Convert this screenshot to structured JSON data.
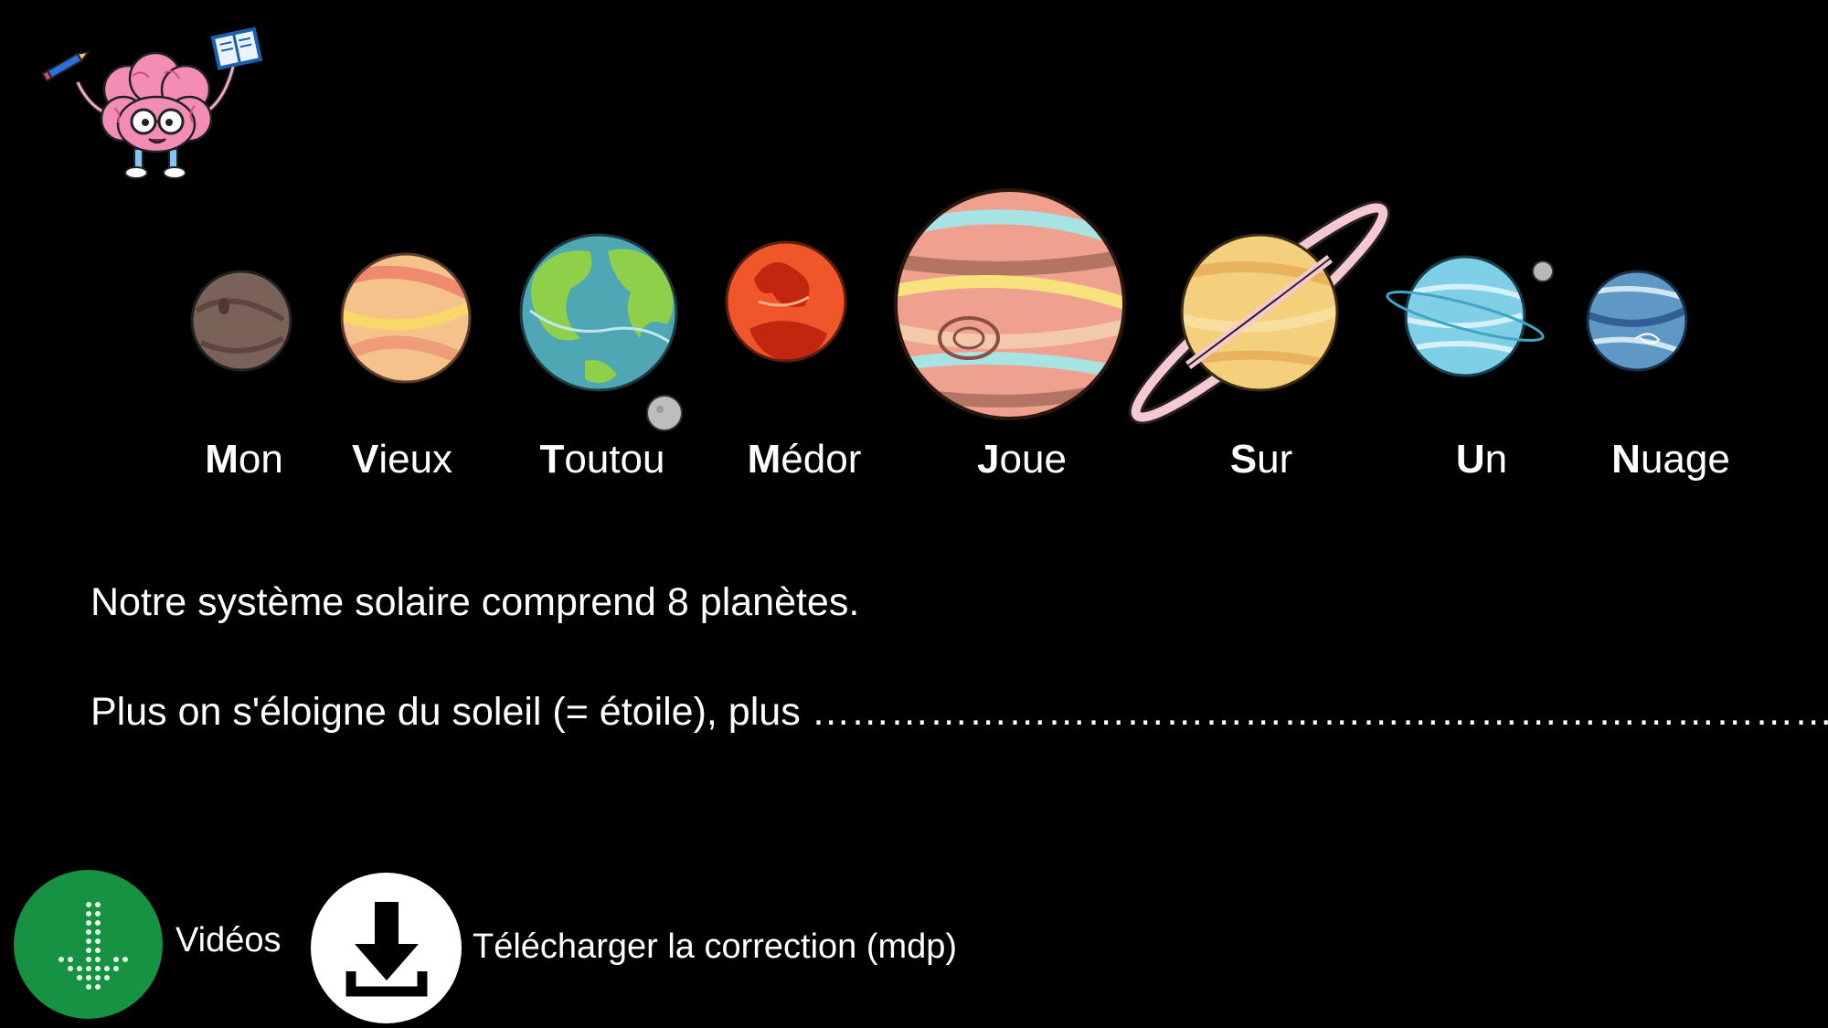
{
  "planets": [
    {
      "first": "M",
      "rest": "on"
    },
    {
      "first": "V",
      "rest": "ieux"
    },
    {
      "first": "T",
      "rest": "outou"
    },
    {
      "first": "M",
      "rest": "édor"
    },
    {
      "first": "J",
      "rest": "oue"
    },
    {
      "first": "S",
      "rest": "ur"
    },
    {
      "first": "U",
      "rest": "n"
    },
    {
      "first": "N",
      "rest": "uage"
    }
  ],
  "text": {
    "line1": "Notre système solaire comprend 8 planètes.",
    "line2": "Plus on s'éloigne du soleil (= étoile), plus …………………………………………………………………………"
  },
  "buttons": {
    "videos_label": "Vidéos",
    "download_label": "Télécharger la correction (mdp)"
  },
  "colors": {
    "background": "#000000",
    "videos_button": "#169242",
    "download_button": "#ffffff"
  },
  "icons": {
    "mascot": "brain-mascot-icon",
    "videos": "arrow-down-dotted-icon",
    "download": "download-icon"
  }
}
